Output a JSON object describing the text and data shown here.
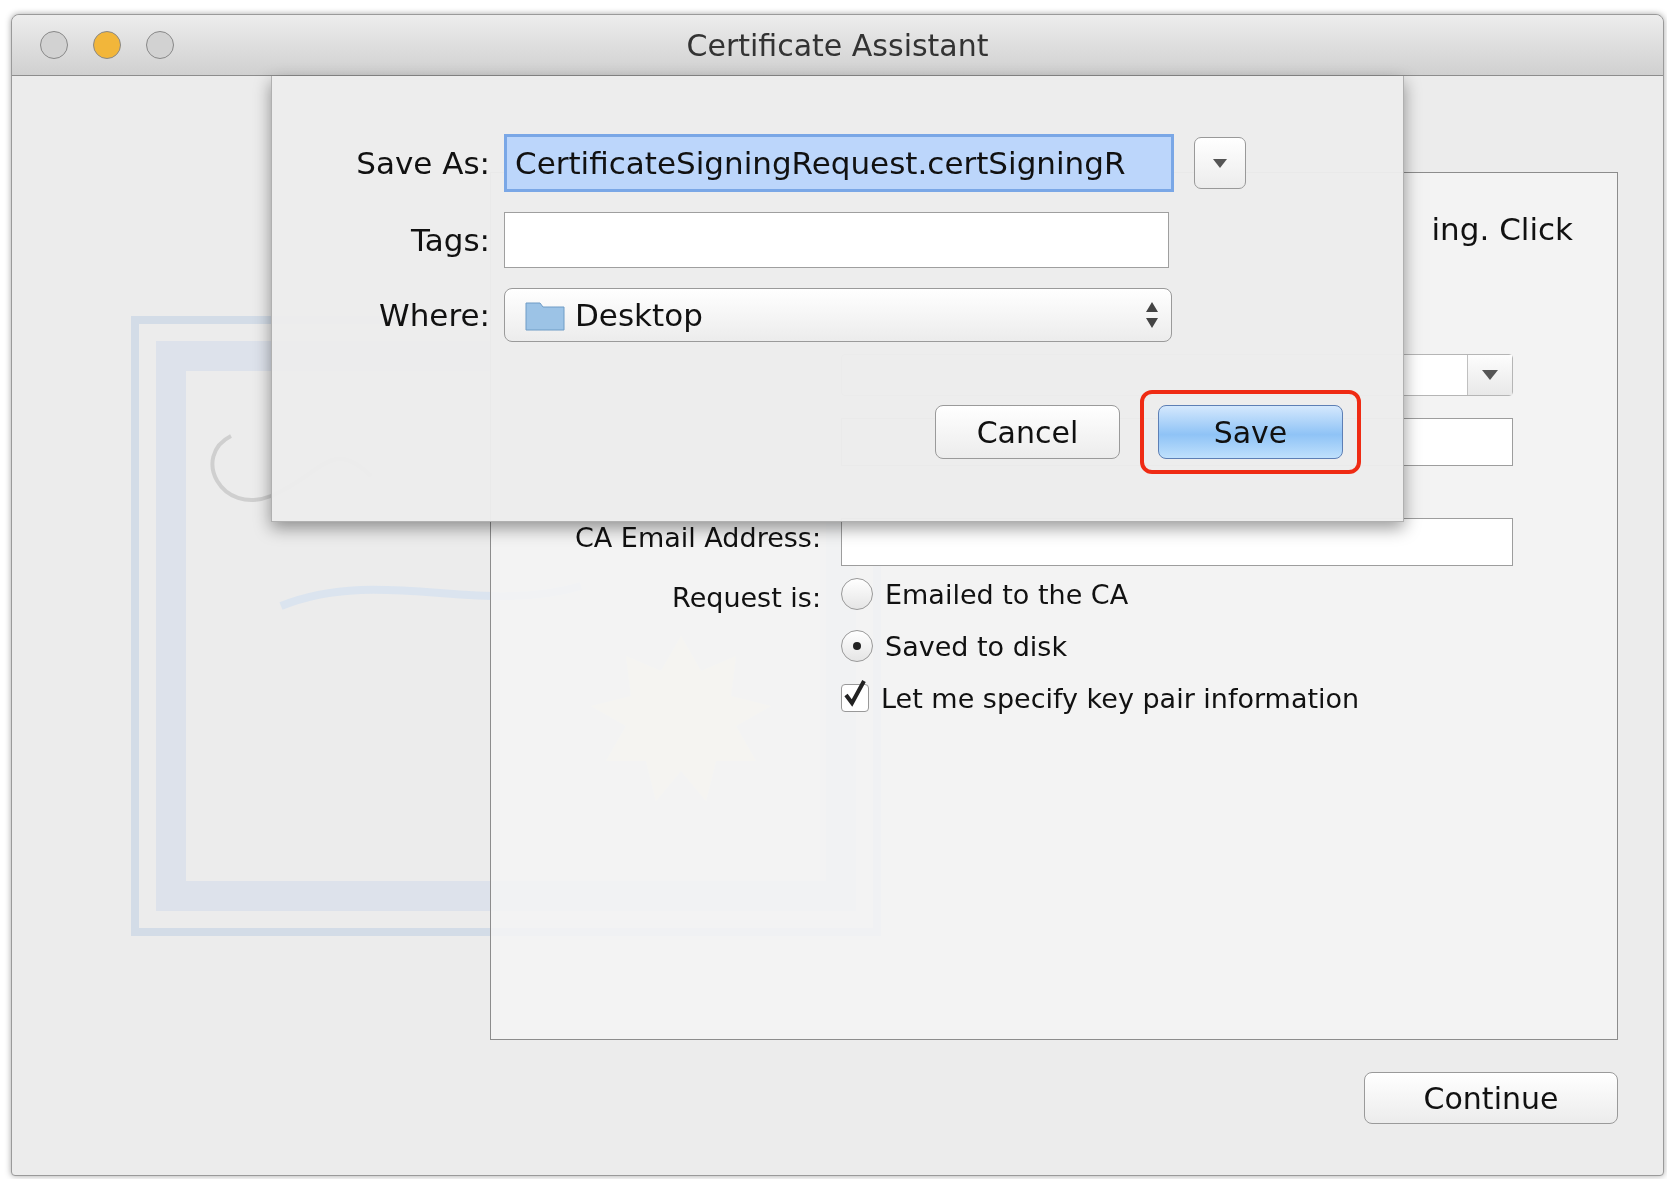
{
  "window": {
    "title": "Certificate Assistant",
    "traffic_lights": [
      {
        "color": "#d2d2d2"
      },
      {
        "color": "#f2b63a"
      },
      {
        "color": "#d2d2d2"
      }
    ]
  },
  "form": {
    "intro_fragment": "ing. Click",
    "ca_email_label": "CA Email Address:",
    "request_label": "Request is:",
    "options": [
      {
        "label": "Emailed to the CA",
        "selected": false
      },
      {
        "label": "Saved to disk",
        "selected": true
      }
    ],
    "key_pair": {
      "label": "Let me specify key pair information",
      "checked": true
    }
  },
  "save_sheet": {
    "save_as_label": "Save As:",
    "save_as_value": "CertificateSigningRequest.certSigningR",
    "tags_label": "Tags:",
    "where_label": "Where:",
    "where_value": "Desktop",
    "buttons": [
      {
        "label": "Cancel",
        "default": false,
        "highlighted": false
      },
      {
        "label": "Save",
        "default": true,
        "highlighted": true
      }
    ]
  },
  "continue_button": "Continue"
}
